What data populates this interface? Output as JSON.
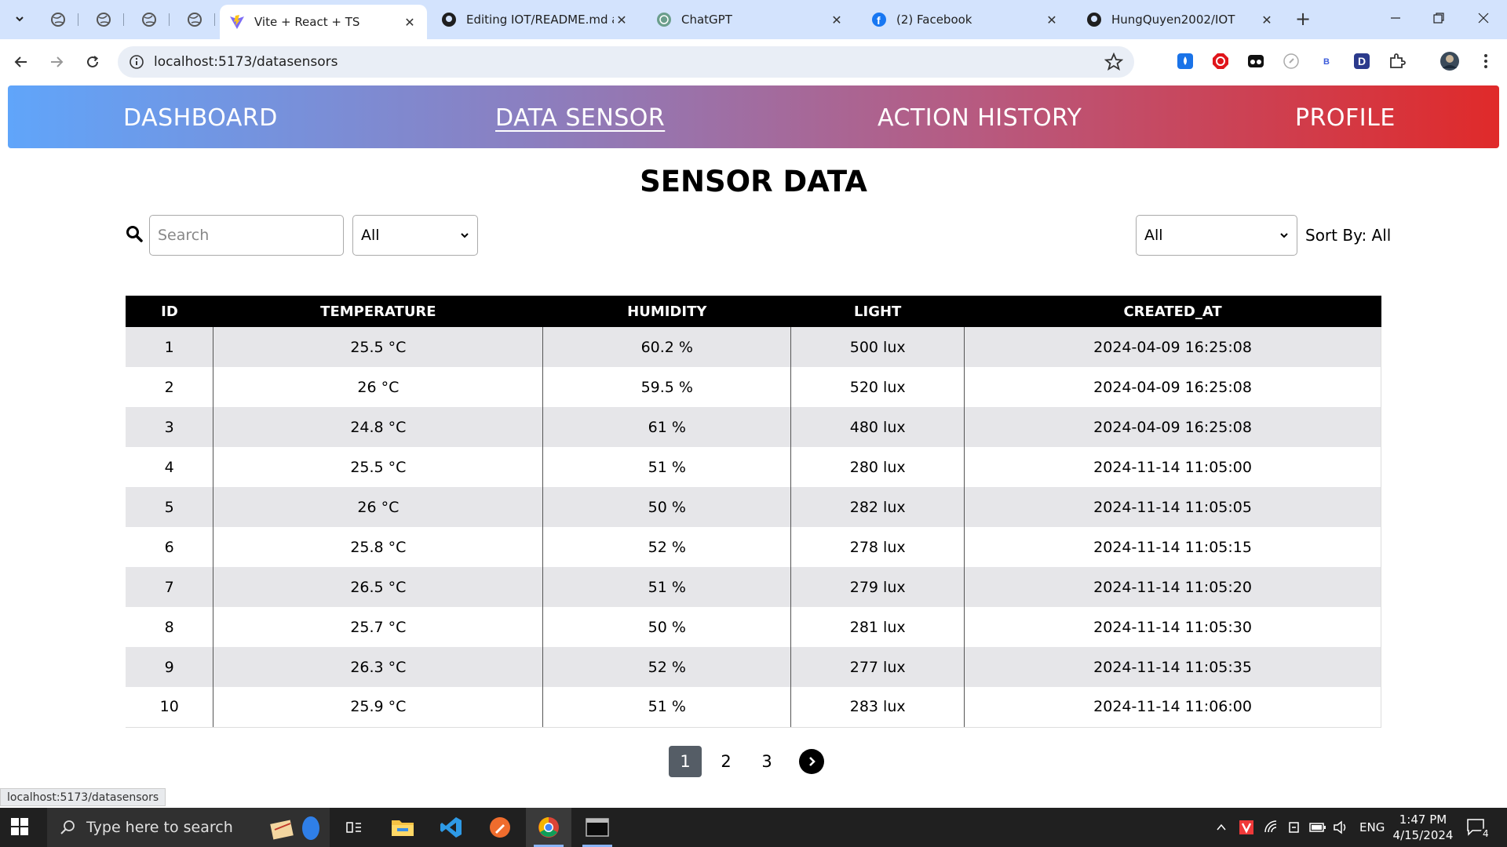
{
  "browser": {
    "tabs": [
      {
        "title": "Vite + React + TS",
        "active": true
      },
      {
        "title": "Editing IOT/README.md at",
        "active": false
      },
      {
        "title": "ChatGPT",
        "active": false
      },
      {
        "title": "(2) Facebook",
        "active": false
      },
      {
        "title": "HungQuyen2002/IOT",
        "active": false
      }
    ],
    "url": "localhost:5173/datasensors",
    "status_url": "localhost:5173/datasensors"
  },
  "nav": {
    "items": [
      "DASHBOARD",
      "DATA SENSOR",
      "ACTION HISTORY",
      "PROFILE"
    ],
    "active": "DATA SENSOR"
  },
  "page": {
    "title": "SENSOR DATA",
    "search_placeholder": "Search",
    "filter_value": "All",
    "sort_select_value": "All",
    "sort_label": "Sort By: All"
  },
  "table": {
    "headers": [
      "ID",
      "TEMPERATURE",
      "HUMIDITY",
      "LIGHT",
      "CREATED_AT"
    ],
    "rows": [
      [
        "1",
        "25.5 °C",
        "60.2 %",
        "500 lux",
        "2024-04-09 16:25:08"
      ],
      [
        "2",
        "26 °C",
        "59.5 %",
        "520 lux",
        "2024-04-09 16:25:08"
      ],
      [
        "3",
        "24.8 °C",
        "61 %",
        "480 lux",
        "2024-04-09 16:25:08"
      ],
      [
        "4",
        "25.5 °C",
        "51 %",
        "280 lux",
        "2024-11-14 11:05:00"
      ],
      [
        "5",
        "26 °C",
        "50 %",
        "282 lux",
        "2024-11-14 11:05:05"
      ],
      [
        "6",
        "25.8 °C",
        "52 %",
        "278 lux",
        "2024-11-14 11:05:15"
      ],
      [
        "7",
        "26.5 °C",
        "51 %",
        "279 lux",
        "2024-11-14 11:05:20"
      ],
      [
        "8",
        "25.7 °C",
        "50 %",
        "281 lux",
        "2024-11-14 11:05:30"
      ],
      [
        "9",
        "26.3 °C",
        "52 %",
        "277 lux",
        "2024-11-14 11:05:35"
      ],
      [
        "10",
        "25.9 °C",
        "51 %",
        "283 lux",
        "2024-11-14 11:06:00"
      ]
    ]
  },
  "pagination": {
    "pages": [
      "1",
      "2",
      "3"
    ],
    "current": "1"
  },
  "taskbar": {
    "search_placeholder": "Type here to search",
    "language": "ENG",
    "time": "1:47 PM",
    "date": "4/15/2024",
    "notifications": "4"
  },
  "colors": {
    "nav_gradient_start": "#60a5fa",
    "nav_gradient_end": "#e02a2a",
    "table_header": "#000000"
  }
}
